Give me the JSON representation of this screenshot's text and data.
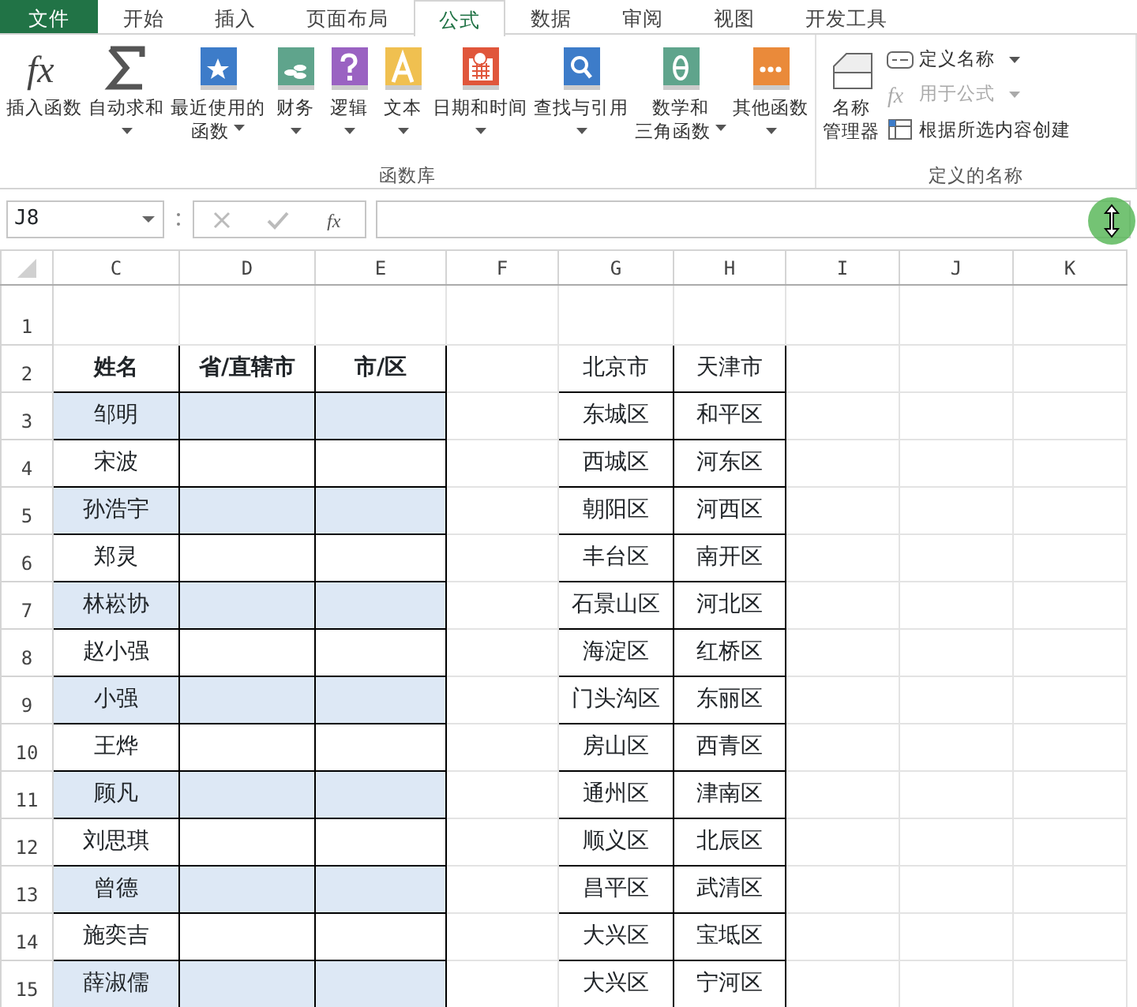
{
  "tabs": [
    {
      "label": "文件",
      "kind": "file",
      "selected": false
    },
    {
      "label": "开始",
      "kind": "tab",
      "selected": false
    },
    {
      "label": "插入",
      "kind": "tab",
      "selected": false
    },
    {
      "label": "页面布局",
      "kind": "tab",
      "selected": false
    },
    {
      "label": "公式",
      "kind": "tab",
      "selected": true
    },
    {
      "label": "数据",
      "kind": "tab",
      "selected": false
    },
    {
      "label": "审阅",
      "kind": "tab",
      "selected": false
    },
    {
      "label": "视图",
      "kind": "tab",
      "selected": false
    },
    {
      "label": "开发工具",
      "kind": "tab",
      "selected": false
    }
  ],
  "ribbon": {
    "groups": [
      {
        "label": "函数库",
        "buttons": [
          {
            "kind": "fx",
            "glyph": "fx",
            "lines": [
              "插入函数"
            ],
            "dropdown": false
          },
          {
            "kind": "sum",
            "lines": [
              "自动求和"
            ],
            "dropdown": true
          },
          {
            "kind": "star",
            "color": "#3d7cc9",
            "lines": [
              "最近使用的",
              "函数"
            ],
            "dropdown": true
          },
          {
            "kind": "coins",
            "color": "#5fa48c",
            "lines": [
              "财务"
            ],
            "dropdown": true
          },
          {
            "kind": "question",
            "color": "#9a62c2",
            "lines": [
              "逻辑"
            ],
            "dropdown": true
          },
          {
            "kind": "letter",
            "color": "#f0c050",
            "lines": [
              "文本"
            ],
            "dropdown": true
          },
          {
            "kind": "calendar",
            "color": "#e0563b",
            "lines": [
              "日期和时间"
            ],
            "dropdown": true
          },
          {
            "kind": "magnifier",
            "color": "#3d7cc9",
            "lines": [
              "查找与引用"
            ],
            "dropdown": true
          },
          {
            "kind": "theta",
            "color": "#5fa48c",
            "lines": [
              "数学和",
              "三角函数"
            ],
            "dropdown": true
          },
          {
            "kind": "dots",
            "color": "#ea8a3a",
            "lines": [
              "其他函数"
            ],
            "dropdown": true
          }
        ]
      },
      {
        "label": "定义的名称",
        "manager": {
          "lines": [
            "名称",
            "管理器"
          ]
        },
        "items": [
          {
            "kind": "define",
            "label": "定义名称",
            "dropdown": true,
            "disabled": false
          },
          {
            "kind": "use",
            "glyph": "fx",
            "label": "用于公式",
            "dropdown": true,
            "disabled": true
          },
          {
            "kind": "create",
            "label": "根据所选内容创建",
            "dropdown": false,
            "disabled": false
          }
        ]
      }
    ]
  },
  "formula_bar": {
    "name_box": "J8",
    "function_glyph": "fx"
  },
  "sheet": {
    "columns": [
      "C",
      "D",
      "E",
      "F",
      "G",
      "H",
      "I",
      "J",
      "K"
    ],
    "rows": [
      {
        "number": "1"
      },
      {
        "number": "2"
      },
      {
        "number": "3"
      },
      {
        "number": "4"
      },
      {
        "number": "5"
      },
      {
        "number": "6"
      },
      {
        "number": "7"
      },
      {
        "number": "8"
      },
      {
        "number": "9"
      },
      {
        "number": "10"
      },
      {
        "number": "11"
      },
      {
        "number": "12"
      },
      {
        "number": "13"
      },
      {
        "number": "14"
      },
      {
        "number": "15"
      }
    ],
    "left_table": {
      "header": [
        "姓名",
        "省/直辖市",
        "市/区"
      ],
      "rows": [
        {
          "name": "邹明",
          "highlighted": true
        },
        {
          "name": "宋波",
          "highlighted": false
        },
        {
          "name": "孙浩宇",
          "highlighted": true
        },
        {
          "name": "郑灵",
          "highlighted": false
        },
        {
          "name": "林崧协",
          "highlighted": true
        },
        {
          "name": "赵小强",
          "highlighted": false
        },
        {
          "name": "小强",
          "highlighted": true
        },
        {
          "name": "王烨",
          "highlighted": false
        },
        {
          "name": "顾凡",
          "highlighted": true
        },
        {
          "name": "刘思琪",
          "highlighted": false
        },
        {
          "name": "曾德",
          "highlighted": true
        },
        {
          "name": "施奕吉",
          "highlighted": false
        },
        {
          "name": "薛淑儒",
          "highlighted": true
        }
      ]
    },
    "right_table": {
      "rows": [
        [
          "北京市",
          "天津市"
        ],
        [
          "东城区",
          "和平区"
        ],
        [
          "西城区",
          "河东区"
        ],
        [
          "朝阳区",
          "河西区"
        ],
        [
          "丰台区",
          "南开区"
        ],
        [
          "石景山区",
          "河北区"
        ],
        [
          "海淀区",
          "红桥区"
        ],
        [
          "门头沟区",
          "东丽区"
        ],
        [
          "房山区",
          "西青区"
        ],
        [
          "通州区",
          "津南区"
        ],
        [
          "顺义区",
          "北辰区"
        ],
        [
          "昌平区",
          "武清区"
        ],
        [
          "大兴区",
          "宝坻区"
        ],
        [
          "大兴区",
          "宁河区"
        ]
      ]
    }
  }
}
